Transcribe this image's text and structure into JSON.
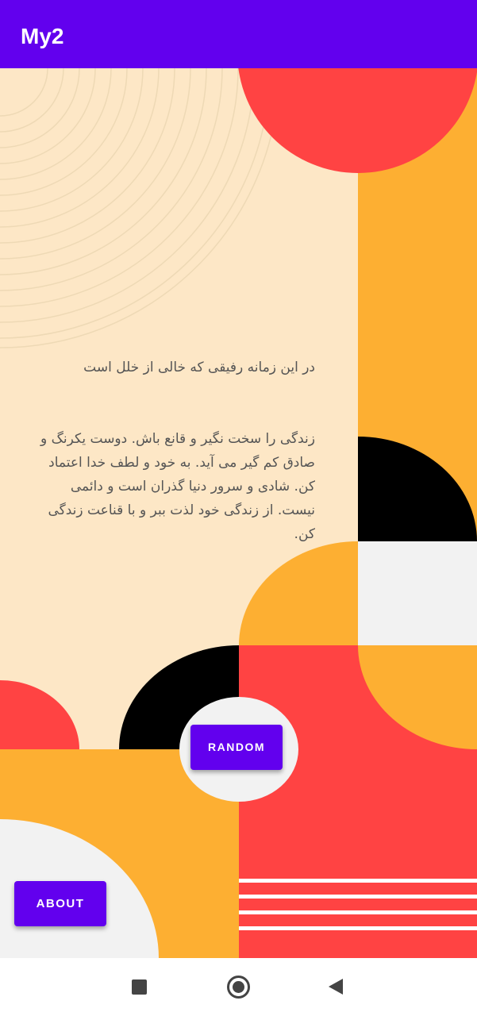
{
  "app_bar": {
    "title": "My2"
  },
  "content": {
    "headline": "در این زمانه رفیقی که خالی از خلل است",
    "paragraph": "زندگی را سخت نگیر و قانع باش. دوست یکرنگ و صادق کم گیر می آید. به خود و لطف خدا اعتماد کن. شادی و سرور دنیا گذران است و دائمی نیست. از زندگی خود لذت ببر و با قناعت زندگی کن."
  },
  "buttons": {
    "random_label": "RANDOM",
    "about_label": "ABOUT"
  },
  "colors": {
    "accent": "#6200EE",
    "cream": "#FDE7C6",
    "red": "#FF4343",
    "orange": "#FDAF32",
    "black": "#000000",
    "light_gray": "#F2F2F2"
  },
  "nav_bar": {
    "icons": [
      "recents-square-icon",
      "home-circle-icon",
      "back-triangle-icon"
    ]
  }
}
